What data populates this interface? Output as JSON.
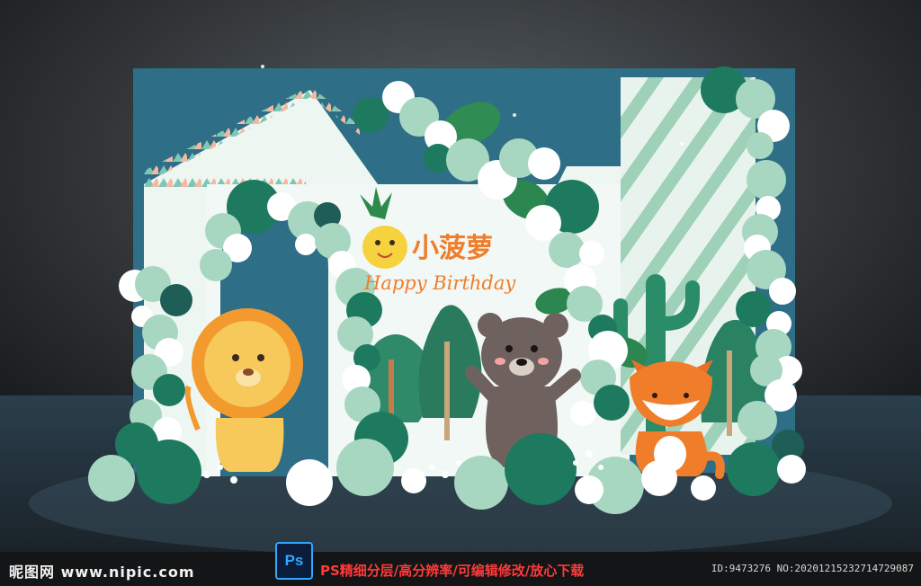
{
  "sign": {
    "name_text": "小菠萝",
    "greeting_text": "Happy Birthday"
  },
  "footer": {
    "site_watermark": "昵图网 www.nipic.com",
    "ps_badge": "Ps",
    "ps_caption": "PS精细分层/高分辨率/可编辑修改/放心下载",
    "id_text": "ID:9473276 NO:20201215232714729087"
  },
  "colors": {
    "backdrop_blue": "#2e6e86",
    "dark_green": "#1e7a5e",
    "mint": "#a7d7c1",
    "white": "#ffffff",
    "orange": "#f07d2a",
    "lion_yellow": "#f2b23c",
    "bear_brown": "#6f625e"
  },
  "icons": [
    "pineapple-icon",
    "photoshop-icon"
  ]
}
